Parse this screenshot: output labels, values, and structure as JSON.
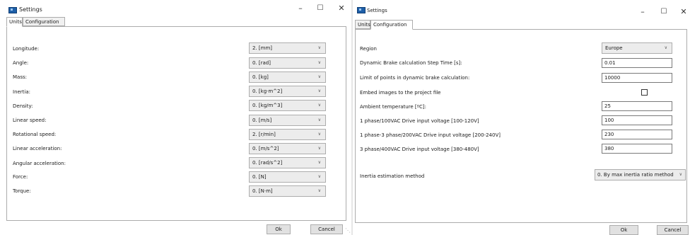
{
  "units_window": {
    "title": "Settings",
    "tabs": [
      "Units",
      "Configuration"
    ],
    "rows": [
      {
        "label": "Longitude:",
        "value": "2.  [mm]"
      },
      {
        "label": "Angle:",
        "value": "0.  [rad]"
      },
      {
        "label": "Mass:",
        "value": "0.  [kg]"
      },
      {
        "label": "Inertia:",
        "value": "0.  [kg·m^2]"
      },
      {
        "label": "Density:",
        "value": "0.  [kg/m^3]"
      },
      {
        "label": "Linear speed:",
        "value": "0.  [m/s]"
      },
      {
        "label": "Rotational speed:",
        "value": "2.  [r/min]"
      },
      {
        "label": "Linear acceleration:",
        "value": "0.  [m/s^2]"
      },
      {
        "label": "Angular acceleration:",
        "value": "0.  [rad/s^2]"
      },
      {
        "label": "Force:",
        "value": "0.  [N]"
      },
      {
        "label": "Torque:",
        "value": "0.  [N·m]"
      }
    ],
    "ok_label": "Ok",
    "cancel_label": "Cancel"
  },
  "config_window": {
    "title": "Settings",
    "tabs": [
      "Units",
      "Configuration"
    ],
    "region_label": "Region",
    "region_value": "Europe",
    "step_time_label": "Dynamic Brake calculation Step Time [s]:",
    "step_time_value": "0.01",
    "limit_points_label": "Limit of points in dynamic brake calculation:",
    "limit_points_value": "10000",
    "embed_images_label": "Embed images to the project file",
    "embed_images_checked": false,
    "ambient_temp_label": "Ambient temperature [ºC]:",
    "ambient_temp_value": "25",
    "v100_label": "1 phase/100VAC Drive input voltage [100-120V]",
    "v100_value": "100",
    "v200_label": "1 phase-3 phase/200VAC Drive input voltage [200-240V]",
    "v200_value": "230",
    "v400_label": "3 phase/400VAC Drive input voltage [380-480V]",
    "v400_value": "380",
    "inertia_method_label": "Inertia estimation method",
    "inertia_method_value": "0. By max inertia ratio method",
    "ok_label": "Ok",
    "cancel_label": "Cancel"
  },
  "window_controls": {
    "minimize": "–",
    "maximize": "☐",
    "close": "✕"
  },
  "icons": {
    "app": "settings-window-icon",
    "dropdown": "chevron-down-icon"
  }
}
